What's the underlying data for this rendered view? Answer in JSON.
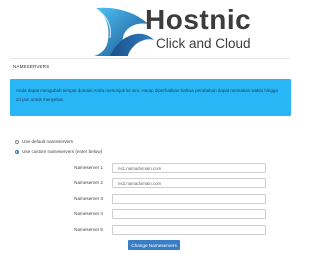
{
  "brand": {
    "name": "Hostnic",
    "tagline": "Click and Cloud",
    "colors": {
      "wave_dark": "#1a4f8a",
      "wave_light": "#4fc3f7",
      "text": "#3c3c3c"
    }
  },
  "section": {
    "title": "NAMESERVERS"
  },
  "alert": {
    "line1": "Anda dapat mengubah tempat domain Anda menunjuk ke sini. Harap diperhatikan bahwa perubahan dapat memakan waktu hingga",
    "line2": "24 jam untuk menyebar.",
    "color": "#29b6f6"
  },
  "options": {
    "default_label": "Use default nameservers",
    "custom_label": "Use custom nameservers (enter below)",
    "selected": "custom"
  },
  "nameservers": [
    {
      "label": "Nameserver 1",
      "value": "ns1.namadomain.com"
    },
    {
      "label": "Nameserver 2",
      "value": "ns2.namadomain.com"
    },
    {
      "label": "Nameserver 3",
      "value": ""
    },
    {
      "label": "Nameserver 4",
      "value": ""
    },
    {
      "label": "Nameserver 5",
      "value": ""
    }
  ],
  "actions": {
    "submit_label": "Change Nameservers",
    "submit_color": "#3a7dc4"
  }
}
